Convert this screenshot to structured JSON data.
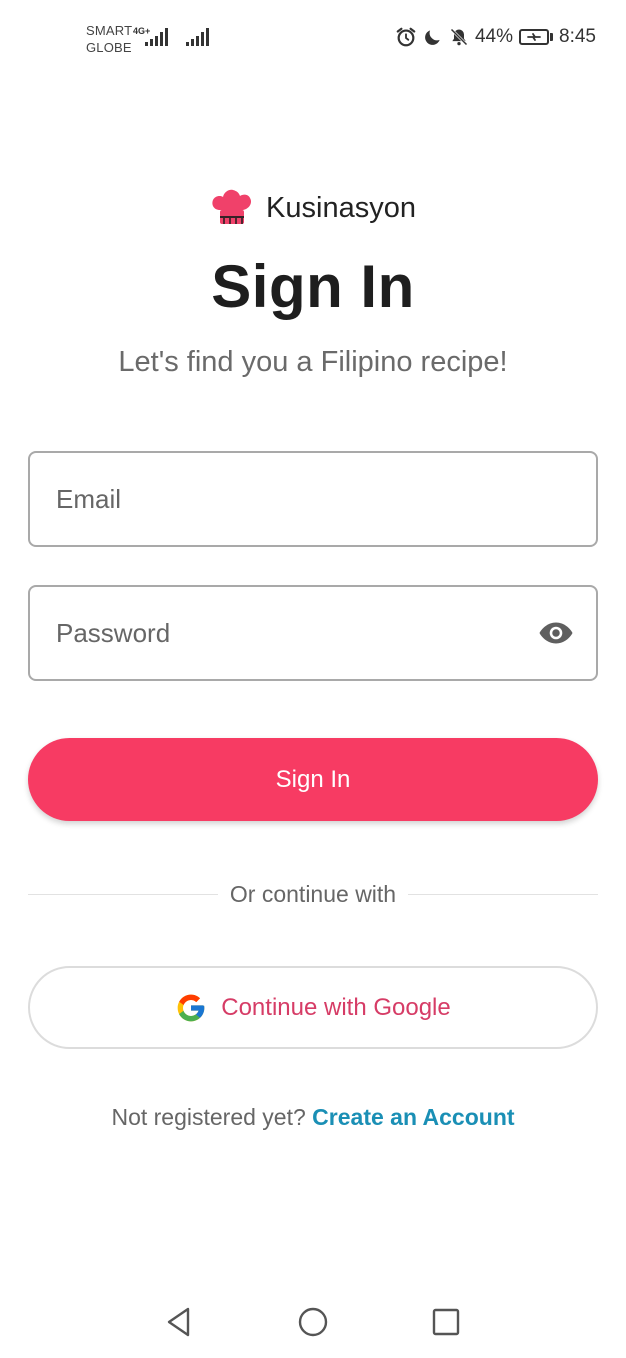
{
  "status_bar": {
    "carrier_1": "SMART",
    "carrier_2": "GLOBE",
    "network_type": "4G+",
    "battery": "44%",
    "time": "8:45",
    "icons": [
      "alarm-icon",
      "moon-icon",
      "bell-off-icon",
      "battery-charging-icon"
    ]
  },
  "brand": {
    "name": "Kusinasyon",
    "logo_icon": "chef-hat-icon",
    "logo_color": "#f0416a"
  },
  "page": {
    "title": "Sign In",
    "subtitle": "Let's find you a Filipino recipe!"
  },
  "form": {
    "email": {
      "value": "",
      "placeholder": "Email"
    },
    "password": {
      "value": "",
      "placeholder": "Password",
      "toggle_icon": "eye-icon"
    },
    "submit_label": "Sign In"
  },
  "divider": {
    "label": "Or continue with"
  },
  "google": {
    "label": "Continue with Google",
    "icon": "google-icon"
  },
  "register": {
    "prompt": "Not registered yet?",
    "link_label": "Create an Account"
  },
  "nav_bar": {
    "icons": [
      "back-icon",
      "home-icon",
      "recent-apps-icon"
    ]
  },
  "colors": {
    "primary": "#f73b63",
    "google_label": "#d63c66",
    "link": "#1a8fb5",
    "text": "#222222",
    "muted": "#666666"
  }
}
